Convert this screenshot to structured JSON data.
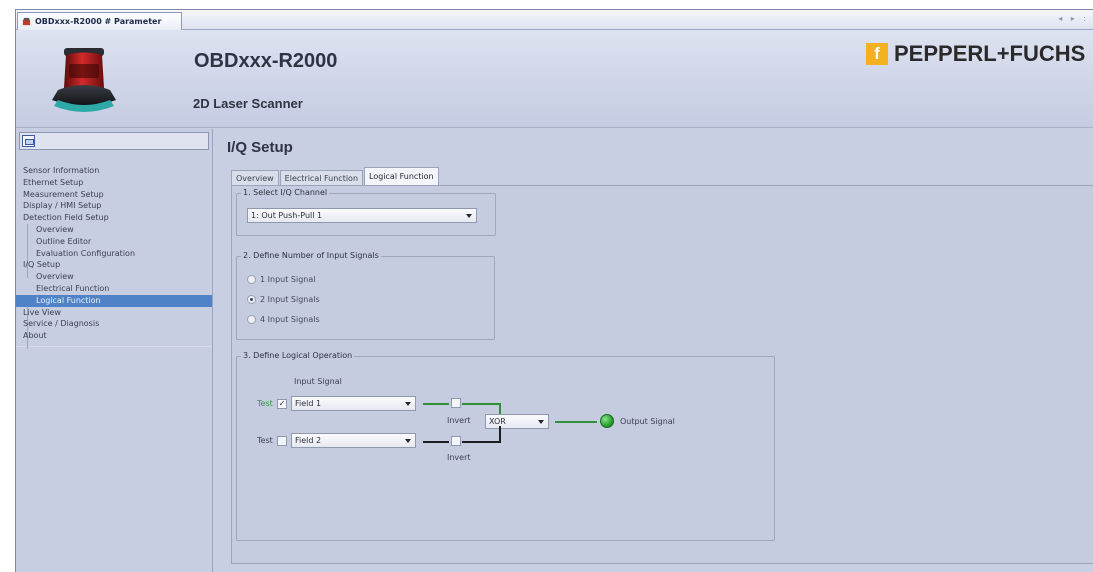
{
  "window": {
    "doc_tab": "OBDxxx-R2000 # Parameter",
    "nav_arrows": "◂ ▸ :"
  },
  "header": {
    "title": "OBDxxx-R2000",
    "subtitle": "2D Laser Scanner",
    "brand": "PEPPERL+FUCHS",
    "brand_logo_letter": "f",
    "brand_color": "#f3b021"
  },
  "sidebar": {
    "toggle_icon": "panel-icon",
    "items": [
      {
        "label": "Sensor Information",
        "level": 0
      },
      {
        "label": "Ethernet Setup",
        "level": 0
      },
      {
        "label": "Measurement Setup",
        "level": 0
      },
      {
        "label": "Display / HMI Setup",
        "level": 0
      },
      {
        "label": "Detection Field Setup",
        "level": 0
      },
      {
        "label": "Overview",
        "level": 1
      },
      {
        "label": "Outline Editor",
        "level": 1
      },
      {
        "label": "Evaluation Configuration",
        "level": 1
      },
      {
        "label": "I/Q Setup",
        "level": 0
      },
      {
        "label": "Overview",
        "level": 1
      },
      {
        "label": "Electrical Function",
        "level": 1
      },
      {
        "label": "Logical Function",
        "level": 1,
        "selected": true
      },
      {
        "label": "Live View",
        "level": 0
      },
      {
        "label": "Service / Diagnosis",
        "level": 0
      },
      {
        "label": "About",
        "level": 0
      }
    ],
    "selected_color": "#4f82c6"
  },
  "main": {
    "title": "I/Q Setup",
    "tabs": [
      {
        "label": "Overview"
      },
      {
        "label": "Electrical Function"
      },
      {
        "label": "Logical Function",
        "active": true
      }
    ],
    "channel_group": {
      "title": "1. Select I/Q Channel",
      "selected": "1: Out Push-Pull 1"
    },
    "inputs_group": {
      "title": "2. Define Number of Input Signals",
      "options": [
        {
          "label": "1 Input Signal",
          "checked": false
        },
        {
          "label": "2 Input Signals",
          "checked": true
        },
        {
          "label": "4 Input Signals",
          "checked": false
        }
      ]
    },
    "logic_group": {
      "title": "3. Define Logical Operation",
      "input_signal_label": "Input Signal",
      "row1": {
        "test_label": "Test",
        "test_checked": true,
        "field": "Field 1",
        "invert_label": "Invert",
        "invert_checked": false
      },
      "row2": {
        "test_label": "Test",
        "test_checked": false,
        "field": "Field 2",
        "invert_label": "Invert",
        "invert_checked": false
      },
      "operator": "XOR",
      "output_label": "Output Signal",
      "check_mark": "✓",
      "active_wire_color": "#2f8f3a",
      "inactive_wire_color": "#1b1d22",
      "output_led_color": "#27a02e"
    }
  }
}
